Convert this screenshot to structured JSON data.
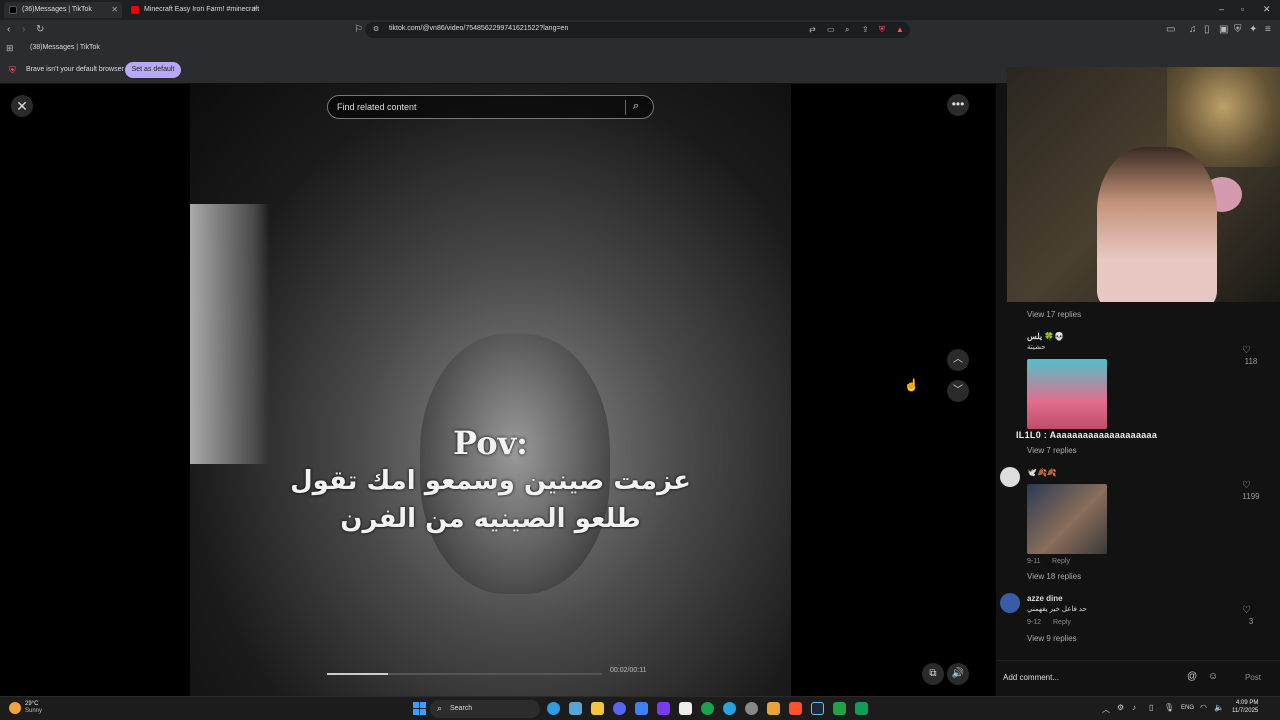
{
  "browser": {
    "tabs": [
      {
        "label": "(36)Messages | TikTok",
        "active": true
      },
      {
        "label": "Minecraft Easy Iron Farm! #minecraft",
        "active": false
      }
    ],
    "new_tab": "+",
    "url": "tiktok.com/@vn86/video/7548562299741621522?lang=en",
    "bookmark": "(38)Messages | TikTok",
    "infobar_text": "Brave isn't your default browser",
    "set_default_label": "Set as default"
  },
  "video": {
    "search_placeholder": "Find related content",
    "caption_pov": "Pov:",
    "caption_line1": "عزمت صينين وسمعو امك تقول",
    "caption_line2": "طلعو الصينيه من الفرن",
    "timecode": "00:02/00:11",
    "progress": 0.22
  },
  "comments": [
    {
      "view_replies": "View 17 replies"
    },
    {
      "name": "يلس 🍀💀",
      "text": "حشيتة",
      "likes": "118",
      "view_replies": "View 7 replies"
    },
    {
      "name": "🕊️🍂🍂",
      "likes": "1199",
      "date": "9-11",
      "reply": "Reply",
      "view_replies": "View 18 replies"
    },
    {
      "name": "azze dine",
      "text": "حد فاعل خير يفهمني",
      "likes": "3",
      "date": "9-12",
      "reply": "Reply",
      "view_replies": "View 9 replies"
    }
  ],
  "ticker": "IL1L0 : Aaaaaaaaaaaaaaaaaaaa",
  "comment_input": {
    "placeholder": "Add comment...",
    "post_label": "Post"
  },
  "taskbar": {
    "temp": "29°C",
    "weather": "Sunny",
    "search_label": "Search",
    "lang": "ENG",
    "time": "4:09 PM",
    "date": "11/7/2025"
  },
  "colors": {
    "accent": "#fe2c55",
    "set_default_bg": "#b9a9f5",
    "panel_bg": "#121212"
  }
}
